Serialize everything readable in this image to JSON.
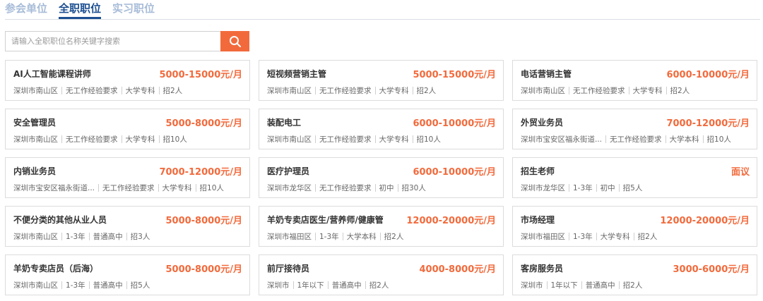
{
  "tabs": [
    {
      "label": "参会单位",
      "active": false
    },
    {
      "label": "全职职位",
      "active": true
    },
    {
      "label": "实习职位",
      "active": false
    }
  ],
  "search": {
    "placeholder": "请输入全职职位名称关键字搜索",
    "button_icon": "search-icon"
  },
  "colors": {
    "accent": "#f26a3c",
    "active_tab": "#1d4f91",
    "inactive_tab": "#a8bcd8"
  },
  "jobs": [
    {
      "title": "AI人工智能课程讲师",
      "salary": "5000-15000元/月",
      "tags": [
        "深圳市南山区",
        "无工作经验要求",
        "大学专科",
        "招2人"
      ]
    },
    {
      "title": "短视频营销主管",
      "salary": "5000-15000元/月",
      "tags": [
        "深圳市南山区",
        "无工作经验要求",
        "大学专科",
        "招2人"
      ]
    },
    {
      "title": "电话营销主管",
      "salary": "6000-10000元/月",
      "tags": [
        "深圳市南山区",
        "无工作经验要求",
        "大学专科",
        "招2人"
      ]
    },
    {
      "title": "安全管理员",
      "salary": "5000-8000元/月",
      "tags": [
        "深圳市南山区",
        "无工作经验要求",
        "大学专科",
        "招10人"
      ]
    },
    {
      "title": "装配电工",
      "salary": "6000-10000元/月",
      "tags": [
        "深圳市南山区",
        "无工作经验要求",
        "大学专科",
        "招10人"
      ]
    },
    {
      "title": "外贸业务员",
      "salary": "7000-12000元/月",
      "tags": [
        "深圳市宝安区福永街道...",
        "无工作经验要求",
        "大学本科",
        "招10人"
      ]
    },
    {
      "title": "内销业务员",
      "salary": "7000-12000元/月",
      "tags": [
        "深圳市宝安区福永街道...",
        "无工作经验要求",
        "大学专科",
        "招10人"
      ]
    },
    {
      "title": "医疗护理员",
      "salary": "6000-10000元/月",
      "tags": [
        "深圳市龙华区",
        "无工作经验要求",
        "初中",
        "招30人"
      ]
    },
    {
      "title": "招生老师",
      "salary": "面议",
      "tags": [
        "深圳市龙华区",
        "1-3年",
        "初中",
        "招5人"
      ]
    },
    {
      "title": "不便分类的其他从业人员",
      "salary": "5000-8000元/月",
      "tags": [
        "深圳市南山区",
        "1-3年",
        "普通高中",
        "招3人"
      ]
    },
    {
      "title": "羊奶专卖店医生/营养师/健康管",
      "salary": "12000-20000元/月",
      "tags": [
        "深圳市福田区",
        "1-3年",
        "大学本科",
        "招2人"
      ]
    },
    {
      "title": "市场经理",
      "salary": "12000-20000元/月",
      "tags": [
        "深圳市福田区",
        "1-3年",
        "大学专科",
        "招2人"
      ]
    },
    {
      "title": "羊奶专卖店员（后海）",
      "salary": "5000-8000元/月",
      "tags": [
        "深圳市南山区",
        "1-3年",
        "普通高中",
        "招5人"
      ]
    },
    {
      "title": "前厅接待员",
      "salary": "4000-8000元/月",
      "tags": [
        "深圳市",
        "1年以下",
        "普通高中",
        "招2人"
      ]
    },
    {
      "title": "客房服务员",
      "salary": "3000-6000元/月",
      "tags": [
        "深圳市",
        "1年以下",
        "普通高中",
        "招2人"
      ]
    }
  ]
}
